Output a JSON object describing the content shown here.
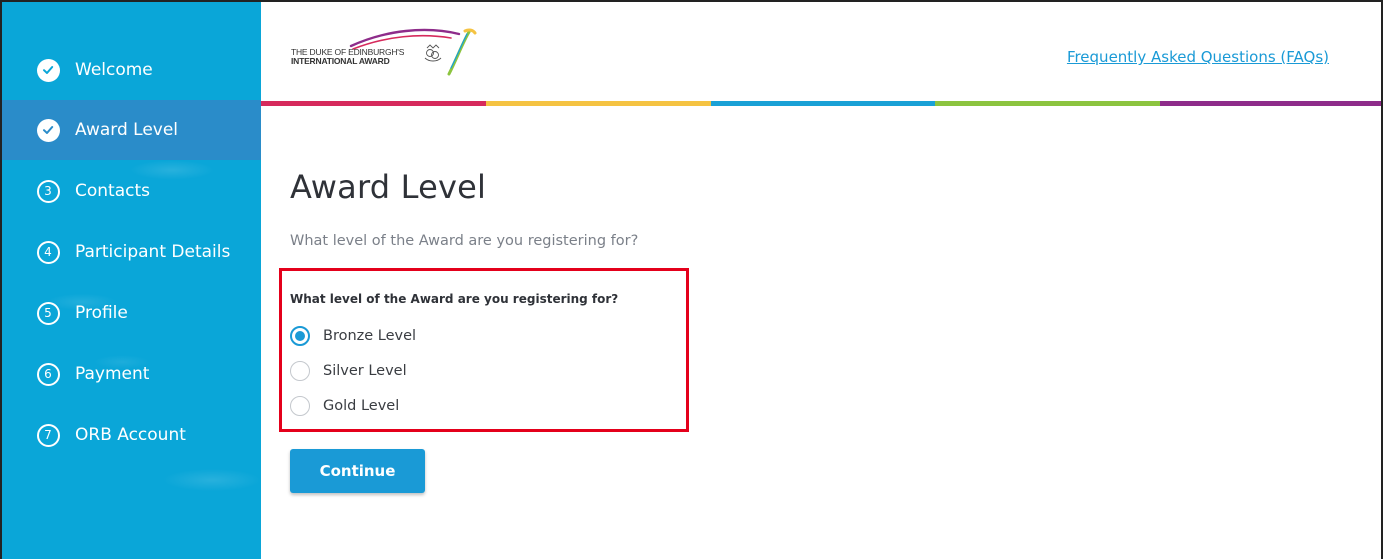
{
  "sidebar": {
    "items": [
      {
        "label": "Welcome",
        "icon": "check-circle-icon",
        "status": "done"
      },
      {
        "label": "Award Level",
        "icon": "check-circle-icon",
        "status": "active"
      },
      {
        "label": "Contacts",
        "number": "3"
      },
      {
        "label": "Participant Details",
        "number": "4"
      },
      {
        "label": "Profile",
        "number": "5"
      },
      {
        "label": "Payment",
        "number": "6"
      },
      {
        "label": "ORB Account",
        "number": "7"
      }
    ],
    "color": "#0aa6d8",
    "active_color": "#2a8cc9"
  },
  "header": {
    "logo_line1": "THE DUKE OF EDINBURGH'S",
    "logo_line2": "INTERNATIONAL AWARD",
    "faq_link": "Frequently Asked Questions (FAQs)",
    "stripe_colors": [
      "#d62a5c",
      "#f5c342",
      "#1aa1d6",
      "#8cc43f",
      "#8e2c8a"
    ]
  },
  "main": {
    "title": "Award Level",
    "intro": "What level of the Award are you registering for?",
    "question": "What level of the Award are you registering for?",
    "options": [
      {
        "label": "Bronze Level",
        "selected": true
      },
      {
        "label": "Silver Level",
        "selected": false
      },
      {
        "label": "Gold Level",
        "selected": false
      }
    ],
    "continue_label": "Continue",
    "accent": "#1a9ad6",
    "highlight_color": "#e4001b"
  }
}
